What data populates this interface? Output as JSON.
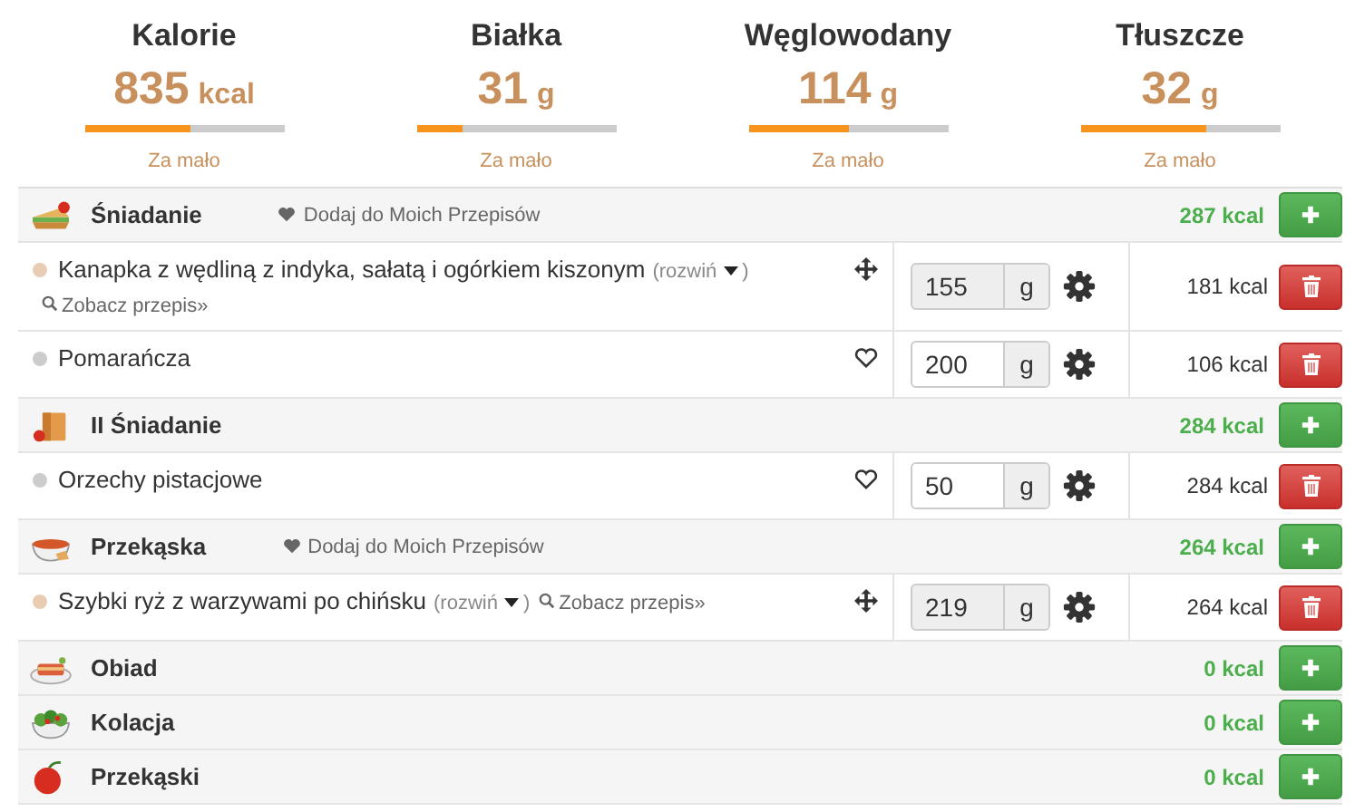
{
  "summary": [
    {
      "label": "Kalorie",
      "value": "835",
      "unit": "kcal",
      "level": 0.53,
      "status": "Za mało"
    },
    {
      "label": "Białka",
      "value": "31",
      "unit": "g",
      "level": 0.23,
      "status": "Za mało"
    },
    {
      "label": "Węglowodany",
      "value": "114",
      "unit": "g",
      "level": 0.5,
      "status": "Za mało"
    },
    {
      "label": "Tłuszcze",
      "value": "32",
      "unit": "g",
      "level": 0.63,
      "status": "Za mało"
    }
  ],
  "meals": [
    {
      "name": "Śniadanie",
      "favorite_link": "Dodaj do Moich Przepisów",
      "kcal": "287 kcal",
      "items": [
        {
          "kind": "recipe",
          "name": "Kanapka z wędliną z indyka, sałatą i ogórkiem kiszonym",
          "expand_open": "(rozwiń",
          "expand_close": ")",
          "recipe_link": "Zobacz przepis»",
          "amount": "155",
          "unit": "g",
          "kcal": "181 kcal"
        },
        {
          "kind": "product",
          "name": "Pomarańcza",
          "amount": "200",
          "unit": "g",
          "kcal": "106 kcal"
        }
      ]
    },
    {
      "name": "II Śniadanie",
      "kcal": "284 kcal",
      "items": [
        {
          "kind": "product",
          "name": "Orzechy pistacjowe",
          "amount": "50",
          "unit": "g",
          "kcal": "284 kcal"
        }
      ]
    },
    {
      "name": "Przekąska",
      "favorite_link": "Dodaj do Moich Przepisów",
      "kcal": "264 kcal",
      "items": [
        {
          "kind": "recipe",
          "name": "Szybki ryż z warzywami po chińsku",
          "expand_open": "(rozwiń",
          "expand_close": ")",
          "recipe_link": "Zobacz przepis»",
          "amount": "219",
          "unit": "g",
          "kcal": "264 kcal"
        }
      ]
    },
    {
      "name": "Obiad",
      "kcal": "0 kcal"
    },
    {
      "name": "Kolacja",
      "kcal": "0 kcal"
    },
    {
      "name": "Przekąski",
      "kcal": "0 kcal"
    }
  ]
}
